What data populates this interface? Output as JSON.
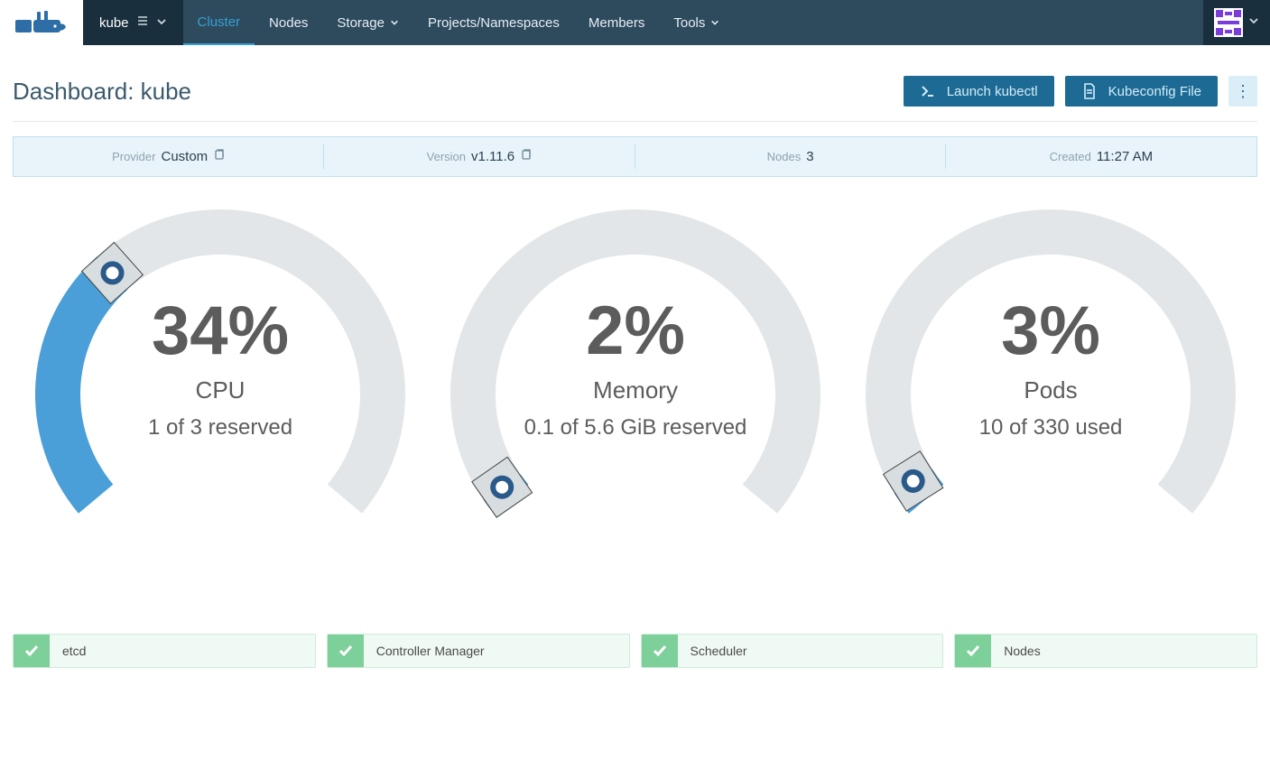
{
  "nav": {
    "cluster_name": "kube",
    "items": [
      "Cluster",
      "Nodes",
      "Storage",
      "Projects/Namespaces",
      "Members",
      "Tools"
    ],
    "active": "Cluster"
  },
  "header": {
    "title": "Dashboard: kube",
    "launch_kubectl": "Launch kubectl",
    "kubeconfig": "Kubeconfig File"
  },
  "info": {
    "provider_label": "Provider",
    "provider_value": "Custom",
    "version_label": "Version",
    "version_value": "v1.11.6",
    "nodes_label": "Nodes",
    "nodes_value": "3",
    "created_label": "Created",
    "created_value": "11:27 AM"
  },
  "chart_data": [
    {
      "type": "gauge",
      "title": "CPU",
      "percent": 34,
      "detail": "1 of 3 reserved"
    },
    {
      "type": "gauge",
      "title": "Memory",
      "percent": 2,
      "detail": "0.1 of 5.6 GiB reserved"
    },
    {
      "type": "gauge",
      "title": "Pods",
      "percent": 3,
      "detail": "10 of 330 used"
    }
  ],
  "components": [
    {
      "name": "etcd",
      "ok": true
    },
    {
      "name": "Controller Manager",
      "ok": true
    },
    {
      "name": "Scheduler",
      "ok": true
    },
    {
      "name": "Nodes",
      "ok": true
    }
  ]
}
